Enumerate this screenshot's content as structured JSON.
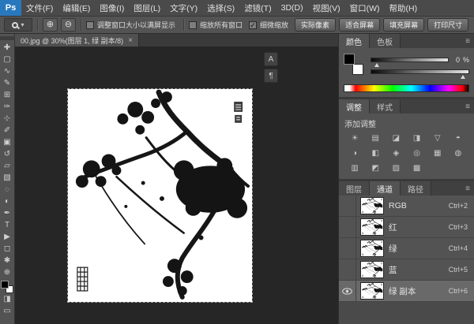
{
  "app": {
    "logo": "Ps"
  },
  "menu": {
    "items": [
      "文件(F)",
      "编辑(E)",
      "图像(I)",
      "图层(L)",
      "文字(Y)",
      "选择(S)",
      "滤镜(T)",
      "3D(D)",
      "视图(V)",
      "窗口(W)",
      "帮助(H)"
    ]
  },
  "options": {
    "tool_dropdown_arrow": "▾",
    "zoom_in_glyph": "⊕",
    "zoom_out_glyph": "⊖",
    "checkboxes": [
      {
        "label": "调整窗口大小以满屏显示",
        "checked": false,
        "mark": ""
      },
      {
        "label": "缩放所有窗口",
        "checked": false,
        "mark": ""
      },
      {
        "label": "细微缩放",
        "checked": true,
        "mark": "✓"
      }
    ],
    "buttons": [
      {
        "label": "实际像素"
      },
      {
        "label": "适合屏幕"
      },
      {
        "label": "填充屏幕"
      },
      {
        "label": "打印尺寸"
      }
    ]
  },
  "document": {
    "tab_title": "00.jpg @ 30%(图层 1, 绿 副本/8)",
    "close_glyph": "×",
    "zoom_level": "30%"
  },
  "toolbar": {
    "tools": [
      {
        "name": "移动工具",
        "glyph": "✚"
      },
      {
        "name": "选框工具",
        "glyph": "▢"
      },
      {
        "name": "套索工具",
        "glyph": "∿"
      },
      {
        "name": "快速选择工具",
        "glyph": "✎"
      },
      {
        "name": "裁剪工具",
        "glyph": "⊞"
      },
      {
        "name": "吸管工具",
        "glyph": "✑"
      },
      {
        "name": "修复画笔工具",
        "glyph": "⊹"
      },
      {
        "name": "画笔工具",
        "glyph": "✐"
      },
      {
        "name": "仿制图章工具",
        "glyph": "▣"
      },
      {
        "name": "历史记录画笔工具",
        "glyph": "↺"
      },
      {
        "name": "橡皮擦工具",
        "glyph": "▱"
      },
      {
        "name": "渐变工具",
        "glyph": "▧"
      },
      {
        "name": "模糊工具",
        "glyph": "◌"
      },
      {
        "name": "减淡工具",
        "glyph": "◐"
      },
      {
        "name": "钢笔工具",
        "glyph": "✒"
      },
      {
        "name": "文字工具",
        "glyph": "T"
      },
      {
        "name": "路径选择工具",
        "glyph": "▶"
      },
      {
        "name": "形状工具",
        "glyph": "◻"
      },
      {
        "name": "抓手工具",
        "glyph": "✱"
      },
      {
        "name": "缩放工具",
        "glyph": "⊕"
      }
    ],
    "quick_mask_glyph": "◨",
    "screen_mode_glyph": "▭"
  },
  "dock": {
    "icons": [
      {
        "name": "字符",
        "glyph": "A"
      },
      {
        "name": "段落",
        "glyph": "¶"
      }
    ]
  },
  "color_panel": {
    "tabs": [
      "颜色",
      "色板"
    ],
    "menu_glyph": "≡",
    "slider_value": "0",
    "slider_unit": "%"
  },
  "adjustments_panel": {
    "tabs": [
      "调整",
      "样式"
    ],
    "menu_glyph": "≡",
    "header": "添加调整",
    "icons": [
      {
        "name": "亮度/对比度",
        "glyph": "☀"
      },
      {
        "name": "色阶",
        "glyph": "▤"
      },
      {
        "name": "曲线",
        "glyph": "◪"
      },
      {
        "name": "曝光度",
        "glyph": "◨"
      },
      {
        "name": "自然饱和度",
        "glyph": "▽"
      },
      {
        "name": "色相/饱和度",
        "glyph": "◓"
      },
      {
        "name": "色彩平衡",
        "glyph": "◑"
      },
      {
        "name": "黑白",
        "glyph": "◧"
      },
      {
        "name": "照片滤镜",
        "glyph": "◈"
      },
      {
        "name": "通道混和器",
        "glyph": "◎"
      },
      {
        "name": "颜色查找",
        "glyph": "▦"
      },
      {
        "name": "反相",
        "glyph": "◍"
      },
      {
        "name": "色调分离",
        "glyph": "▥"
      },
      {
        "name": "阈值",
        "glyph": "◩"
      },
      {
        "name": "可选颜色",
        "glyph": "▨"
      },
      {
        "name": "渐变映射",
        "glyph": "▩"
      }
    ]
  },
  "channels_panel": {
    "tabs": [
      "图层",
      "通道",
      "路径"
    ],
    "menu_glyph": "≡",
    "rows": [
      {
        "name": "RGB",
        "shortcut": "Ctrl+2",
        "visible": false,
        "selected": false
      },
      {
        "name": "红",
        "shortcut": "Ctrl+3",
        "visible": false,
        "selected": false
      },
      {
        "name": "绿",
        "shortcut": "Ctrl+4",
        "visible": false,
        "selected": false
      },
      {
        "name": "蓝",
        "shortcut": "Ctrl+5",
        "visible": false,
        "selected": false
      },
      {
        "name": "绿 副本",
        "shortcut": "Ctrl+6",
        "visible": true,
        "selected": true
      }
    ]
  },
  "colors": {
    "chrome": "#535353",
    "canvas_bg": "#262626",
    "logo_blue": "#2878bd",
    "ink": "#141414"
  }
}
